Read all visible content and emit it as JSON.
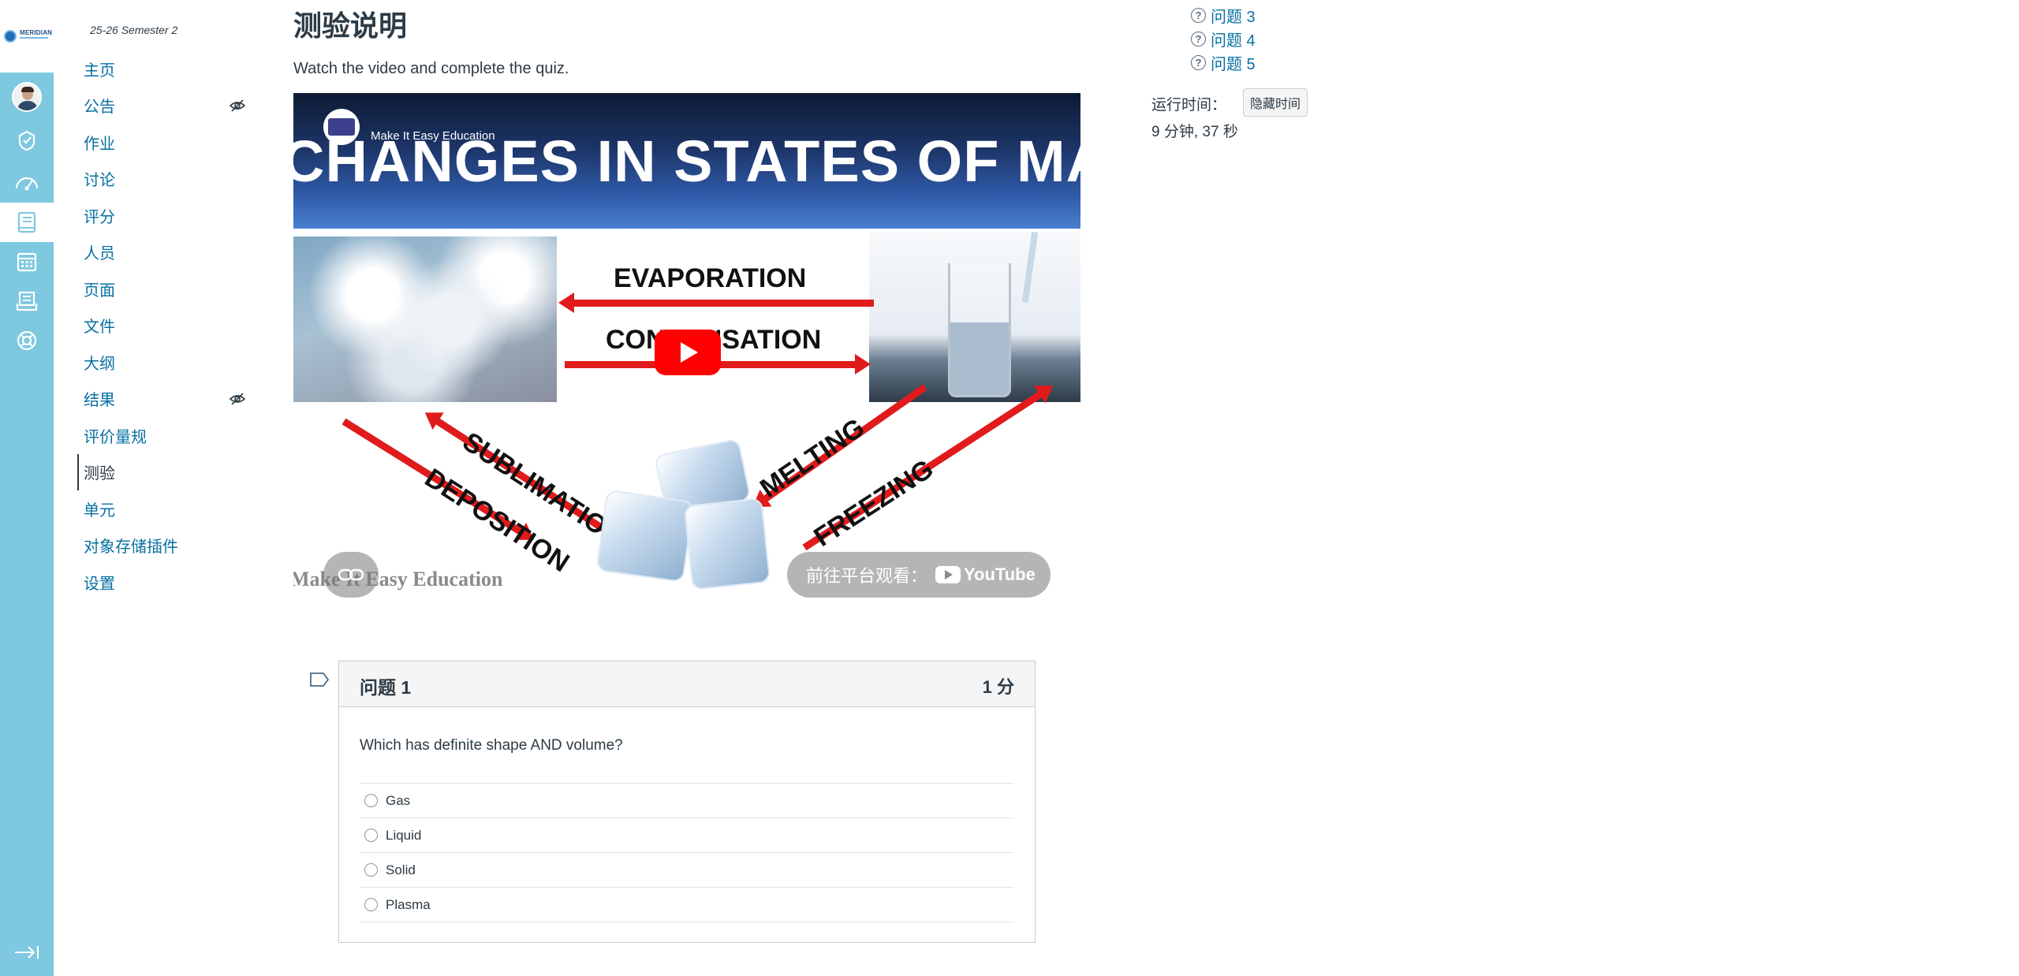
{
  "rail": {
    "logo_text": "MERIDIAN",
    "items": [
      {
        "icon": "avatar"
      },
      {
        "icon": "admin-shield-icon"
      },
      {
        "icon": "dashboard-gauge-icon"
      },
      {
        "icon": "courses-book-icon"
      },
      {
        "icon": "calendar-icon"
      },
      {
        "icon": "inbox-icon"
      },
      {
        "icon": "help-lifebuoy-icon"
      }
    ],
    "collapse_icon": "collapse-nav-icon"
  },
  "course": {
    "term": "25-26 Semester 2",
    "nav": [
      {
        "label": "主页",
        "hidden": false,
        "active": false
      },
      {
        "label": "公告",
        "hidden": true,
        "active": false
      },
      {
        "label": "作业",
        "hidden": false,
        "active": false
      },
      {
        "label": "讨论",
        "hidden": false,
        "active": false
      },
      {
        "label": "评分",
        "hidden": false,
        "active": false
      },
      {
        "label": "人员",
        "hidden": false,
        "active": false
      },
      {
        "label": "页面",
        "hidden": false,
        "active": false
      },
      {
        "label": "文件",
        "hidden": false,
        "active": false
      },
      {
        "label": "大纲",
        "hidden": false,
        "active": false
      },
      {
        "label": "结果",
        "hidden": true,
        "active": false
      },
      {
        "label": "评价量规",
        "hidden": false,
        "active": false
      },
      {
        "label": "测验",
        "hidden": false,
        "active": true
      },
      {
        "label": "单元",
        "hidden": false,
        "active": false
      },
      {
        "label": "对象存储插件",
        "hidden": false,
        "active": false
      },
      {
        "label": "设置",
        "hidden": false,
        "active": false
      }
    ]
  },
  "quiz": {
    "title": "测验说明",
    "description": "Watch the video and complete the quiz."
  },
  "video": {
    "banner_text": "CHANGES IN STATES OF MATTER",
    "channel": "Make It Easy Education",
    "labels": {
      "evaporation": "EVAPORATION",
      "condensation": "CONDENSATION",
      "sublimation": "SUBLIMATION",
      "deposition": "DEPOSITION",
      "melting": "MELTING",
      "freezing": "FREEZING"
    },
    "watermark": "Make It Easy Education",
    "watch_on": "前往平台观看：",
    "youtube": "YouTube"
  },
  "question": {
    "name": "问题 1",
    "points": "1 分",
    "text": "Which has definite shape AND volume?",
    "answers": [
      "Gas",
      "Liquid",
      "Solid",
      "Plasma"
    ]
  },
  "sidebar": {
    "question_links": [
      "问题 3",
      "问题 4",
      "问题 5"
    ],
    "timer_label": "运行时间：",
    "hide_timer": "隐藏时间",
    "timer_value": "9 分钟, 37 秒"
  },
  "colors": {
    "rail": "#7ec8e0",
    "link": "#0770a3",
    "text": "#2d3b45",
    "arrow": "#e11b1b",
    "youtube_red": "#ff0000"
  }
}
